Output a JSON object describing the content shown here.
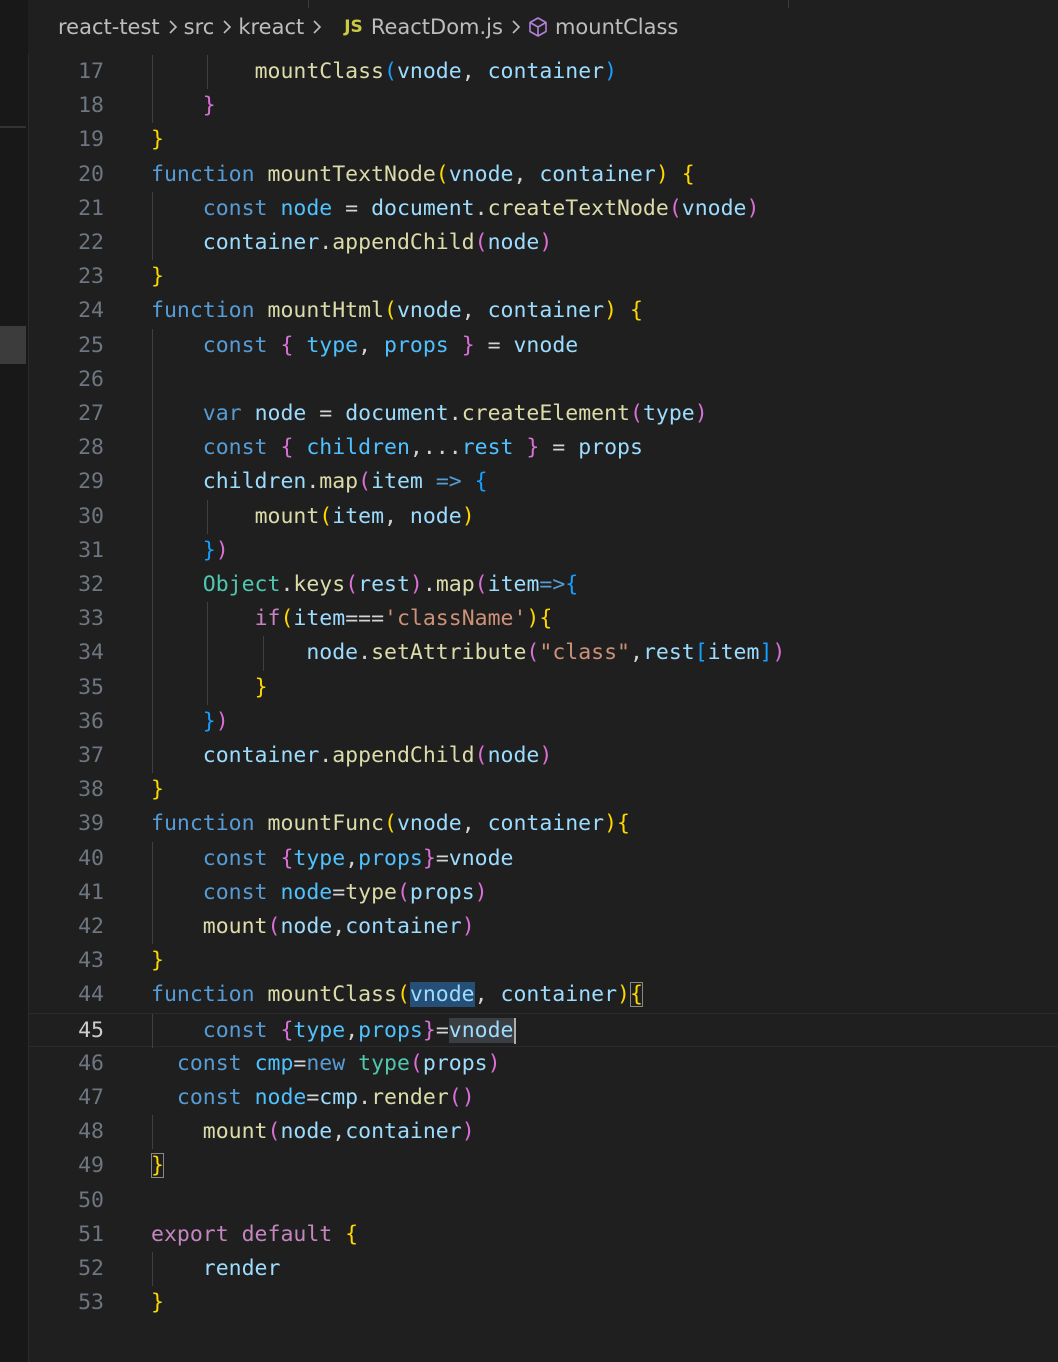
{
  "breadcrumb": {
    "items": [
      {
        "label": "react-test",
        "icon": "folder"
      },
      {
        "label": "src",
        "icon": "folder"
      },
      {
        "label": "kreact",
        "icon": "folder"
      },
      {
        "label": "ReactDom.js",
        "icon": "js-file-icon",
        "icon_text": "JS"
      },
      {
        "label": "mountClass",
        "icon": "cube-icon"
      }
    ]
  },
  "colors": {
    "background": "#1f1f1f",
    "keyword": "#569cd6",
    "control_keyword": "#c586c0",
    "function": "#dcdcaa",
    "variable": "#9cdcfe",
    "constant": "#4fc1ff",
    "string": "#ce9178",
    "class": "#4ec9b0",
    "bracket_gold": "#ffd700",
    "bracket_orchid": "#da70d6",
    "bracket_blue": "#179fff"
  },
  "editor": {
    "current_line": 45,
    "lines": [
      {
        "n": "17",
        "indent": 2,
        "tokens": [
          [
            "mountClass",
            "fn"
          ],
          [
            "(",
            "p3"
          ],
          [
            "vnode",
            "var"
          ],
          [
            ", ",
            "op"
          ],
          [
            "container",
            "var"
          ],
          [
            ")",
            "p3"
          ]
        ]
      },
      {
        "n": "18",
        "indent": 1,
        "tokens": [
          [
            "}",
            "p2"
          ]
        ]
      },
      {
        "n": "19",
        "indent": 0,
        "tokens": [
          [
            "}",
            "p1"
          ]
        ]
      },
      {
        "n": "20",
        "indent": 0,
        "tokens": [
          [
            "function ",
            "kw"
          ],
          [
            "mountTextNode",
            "fn"
          ],
          [
            "(",
            "p1"
          ],
          [
            "vnode",
            "var"
          ],
          [
            ", ",
            "op"
          ],
          [
            "container",
            "var"
          ],
          [
            ")",
            "p1"
          ],
          [
            " ",
            "op"
          ],
          [
            "{",
            "p1"
          ]
        ]
      },
      {
        "n": "21",
        "indent": 1,
        "tokens": [
          [
            "const ",
            "kw"
          ],
          [
            "node",
            "cnst"
          ],
          [
            " = ",
            "op"
          ],
          [
            "document",
            "var"
          ],
          [
            ".",
            "op"
          ],
          [
            "createTextNode",
            "fn"
          ],
          [
            "(",
            "p2"
          ],
          [
            "vnode",
            "var"
          ],
          [
            ")",
            "p2"
          ]
        ]
      },
      {
        "n": "22",
        "indent": 1,
        "tokens": [
          [
            "container",
            "var"
          ],
          [
            ".",
            "op"
          ],
          [
            "appendChild",
            "fn"
          ],
          [
            "(",
            "p2"
          ],
          [
            "node",
            "var"
          ],
          [
            ")",
            "p2"
          ]
        ]
      },
      {
        "n": "23",
        "indent": 0,
        "tokens": [
          [
            "}",
            "p1"
          ]
        ]
      },
      {
        "n": "24",
        "indent": 0,
        "tokens": [
          [
            "function ",
            "kw"
          ],
          [
            "mountHtml",
            "fn"
          ],
          [
            "(",
            "p1"
          ],
          [
            "vnode",
            "var"
          ],
          [
            ", ",
            "op"
          ],
          [
            "container",
            "var"
          ],
          [
            ")",
            "p1"
          ],
          [
            " ",
            "op"
          ],
          [
            "{",
            "p1"
          ]
        ]
      },
      {
        "n": "25",
        "indent": 1,
        "tokens": [
          [
            "const ",
            "kw"
          ],
          [
            "{ ",
            "p2"
          ],
          [
            "type",
            "cnst"
          ],
          [
            ", ",
            "op"
          ],
          [
            "props",
            "cnst"
          ],
          [
            " }",
            "p2"
          ],
          [
            " = ",
            "op"
          ],
          [
            "vnode",
            "var"
          ]
        ]
      },
      {
        "n": "26",
        "indent": 1,
        "tokens": []
      },
      {
        "n": "27",
        "indent": 1,
        "tokens": [
          [
            "var ",
            "kw"
          ],
          [
            "node",
            "var"
          ],
          [
            " = ",
            "op"
          ],
          [
            "document",
            "var"
          ],
          [
            ".",
            "op"
          ],
          [
            "createElement",
            "fn"
          ],
          [
            "(",
            "p2"
          ],
          [
            "type",
            "var"
          ],
          [
            ")",
            "p2"
          ]
        ]
      },
      {
        "n": "28",
        "indent": 1,
        "tokens": [
          [
            "const ",
            "kw"
          ],
          [
            "{ ",
            "p2"
          ],
          [
            "children",
            "cnst"
          ],
          [
            ",...",
            "op"
          ],
          [
            "rest",
            "cnst"
          ],
          [
            " }",
            "p2"
          ],
          [
            " = ",
            "op"
          ],
          [
            "props",
            "var"
          ]
        ]
      },
      {
        "n": "29",
        "indent": 1,
        "tokens": [
          [
            "children",
            "var"
          ],
          [
            ".",
            "op"
          ],
          [
            "map",
            "fn"
          ],
          [
            "(",
            "p2"
          ],
          [
            "item",
            "var"
          ],
          [
            " => ",
            "kw"
          ],
          [
            "{",
            "p3"
          ]
        ]
      },
      {
        "n": "30",
        "indent": 2,
        "tokens": [
          [
            "mount",
            "fn"
          ],
          [
            "(",
            "p1"
          ],
          [
            "item",
            "var"
          ],
          [
            ", ",
            "op"
          ],
          [
            "node",
            "var"
          ],
          [
            ")",
            "p1"
          ]
        ]
      },
      {
        "n": "31",
        "indent": 1,
        "tokens": [
          [
            "}",
            "p3"
          ],
          [
            ")",
            "p2"
          ]
        ]
      },
      {
        "n": "32",
        "indent": 1,
        "tokens": [
          [
            "Object",
            "cls"
          ],
          [
            ".",
            "op"
          ],
          [
            "keys",
            "fn"
          ],
          [
            "(",
            "p2"
          ],
          [
            "rest",
            "var"
          ],
          [
            ")",
            "p2"
          ],
          [
            ".",
            "op"
          ],
          [
            "map",
            "fn"
          ],
          [
            "(",
            "p2"
          ],
          [
            "item",
            "var"
          ],
          [
            "=>",
            "kw"
          ],
          [
            "{",
            "p3"
          ]
        ]
      },
      {
        "n": "33",
        "indent": 2,
        "tokens": [
          [
            "if",
            "kw2"
          ],
          [
            "(",
            "p1"
          ],
          [
            "item",
            "var"
          ],
          [
            "===",
            "op"
          ],
          [
            "'className'",
            "str"
          ],
          [
            ")",
            "p1"
          ],
          [
            "{",
            "p1"
          ]
        ]
      },
      {
        "n": "34",
        "indent": 3,
        "tokens": [
          [
            "node",
            "var"
          ],
          [
            ".",
            "op"
          ],
          [
            "setAttribute",
            "fn"
          ],
          [
            "(",
            "p2"
          ],
          [
            "\"class\"",
            "str"
          ],
          [
            ",",
            "op"
          ],
          [
            "rest",
            "var"
          ],
          [
            "[",
            "p3"
          ],
          [
            "item",
            "var"
          ],
          [
            "]",
            "p3"
          ],
          [
            ")",
            "p2"
          ]
        ]
      },
      {
        "n": "35",
        "indent": 2,
        "tokens": [
          [
            "}",
            "p1"
          ]
        ]
      },
      {
        "n": "36",
        "indent": 1,
        "tokens": [
          [
            "}",
            "p3"
          ],
          [
            ")",
            "p2"
          ]
        ]
      },
      {
        "n": "37",
        "indent": 1,
        "tokens": [
          [
            "container",
            "var"
          ],
          [
            ".",
            "op"
          ],
          [
            "appendChild",
            "fn"
          ],
          [
            "(",
            "p2"
          ],
          [
            "node",
            "var"
          ],
          [
            ")",
            "p2"
          ]
        ]
      },
      {
        "n": "38",
        "indent": 0,
        "tokens": [
          [
            "}",
            "p1"
          ]
        ]
      },
      {
        "n": "39",
        "indent": 0,
        "tokens": [
          [
            "function ",
            "kw"
          ],
          [
            "mountFunc",
            "fn"
          ],
          [
            "(",
            "p1"
          ],
          [
            "vnode",
            "var"
          ],
          [
            ", ",
            "op"
          ],
          [
            "container",
            "var"
          ],
          [
            ")",
            "p1"
          ],
          [
            "{",
            "p1"
          ]
        ]
      },
      {
        "n": "40",
        "indent": 1,
        "tokens": [
          [
            "const ",
            "kw"
          ],
          [
            "{",
            "p2"
          ],
          [
            "type",
            "cnst"
          ],
          [
            ",",
            "op"
          ],
          [
            "props",
            "cnst"
          ],
          [
            "}",
            "p2"
          ],
          [
            "=",
            "op"
          ],
          [
            "vnode",
            "var"
          ]
        ]
      },
      {
        "n": "41",
        "indent": 1,
        "tokens": [
          [
            "const ",
            "kw"
          ],
          [
            "node",
            "cnst"
          ],
          [
            "=",
            "op"
          ],
          [
            "type",
            "fn"
          ],
          [
            "(",
            "p2"
          ],
          [
            "props",
            "var"
          ],
          [
            ")",
            "p2"
          ]
        ]
      },
      {
        "n": "42",
        "indent": 1,
        "tokens": [
          [
            "mount",
            "fn"
          ],
          [
            "(",
            "p2"
          ],
          [
            "node",
            "var"
          ],
          [
            ",",
            "op"
          ],
          [
            "container",
            "var"
          ],
          [
            ")",
            "p2"
          ]
        ]
      },
      {
        "n": "43",
        "indent": 0,
        "tokens": [
          [
            "}",
            "p1"
          ]
        ]
      },
      {
        "n": "44",
        "indent": 0,
        "tokens": [
          [
            "function ",
            "kw"
          ],
          [
            "mountClass",
            "fn"
          ],
          [
            "(",
            "p1"
          ],
          [
            "vnode",
            "var",
            "hl1"
          ],
          [
            ", ",
            "op"
          ],
          [
            "container",
            "var"
          ],
          [
            ")",
            "p1"
          ],
          [
            "{",
            "p1",
            "bm"
          ]
        ]
      },
      {
        "n": "45",
        "indent": 1,
        "tokens": [
          [
            "const ",
            "kw"
          ],
          [
            "{",
            "p2"
          ],
          [
            "type",
            "cnst"
          ],
          [
            ",",
            "op"
          ],
          [
            "props",
            "cnst"
          ],
          [
            "}",
            "p2"
          ],
          [
            "=",
            "op"
          ],
          [
            "vnode",
            "var",
            "hl2"
          ]
        ],
        "cursor": true
      },
      {
        "n": "46",
        "indent": 0,
        "pad": "  ",
        "tokens": [
          [
            "const ",
            "kw"
          ],
          [
            "cmp",
            "cnst"
          ],
          [
            "=",
            "op"
          ],
          [
            "new ",
            "kw"
          ],
          [
            "type",
            "cls"
          ],
          [
            "(",
            "p2"
          ],
          [
            "props",
            "var"
          ],
          [
            ")",
            "p2"
          ]
        ]
      },
      {
        "n": "47",
        "indent": 0,
        "pad": "  ",
        "tokens": [
          [
            "const ",
            "kw"
          ],
          [
            "node",
            "cnst"
          ],
          [
            "=",
            "op"
          ],
          [
            "cmp",
            "var"
          ],
          [
            ".",
            "op"
          ],
          [
            "render",
            "fn"
          ],
          [
            "(",
            "p2"
          ],
          [
            ")",
            "p2"
          ]
        ]
      },
      {
        "n": "48",
        "indent": 1,
        "tokens": [
          [
            "mount",
            "fn"
          ],
          [
            "(",
            "p2"
          ],
          [
            "node",
            "var"
          ],
          [
            ",",
            "op"
          ],
          [
            "container",
            "var"
          ],
          [
            ")",
            "p2"
          ]
        ]
      },
      {
        "n": "49",
        "indent": 0,
        "tokens": [
          [
            "}",
            "p1",
            "bm"
          ]
        ]
      },
      {
        "n": "50",
        "indent": 0,
        "tokens": []
      },
      {
        "n": "51",
        "indent": 0,
        "tokens": [
          [
            "export ",
            "kw2"
          ],
          [
            "default ",
            "kw2"
          ],
          [
            "{",
            "p1"
          ]
        ]
      },
      {
        "n": "52",
        "indent": 1,
        "tokens": [
          [
            "render",
            "var"
          ]
        ]
      },
      {
        "n": "53",
        "indent": 0,
        "tokens": [
          [
            "}",
            "p1"
          ]
        ]
      }
    ]
  }
}
